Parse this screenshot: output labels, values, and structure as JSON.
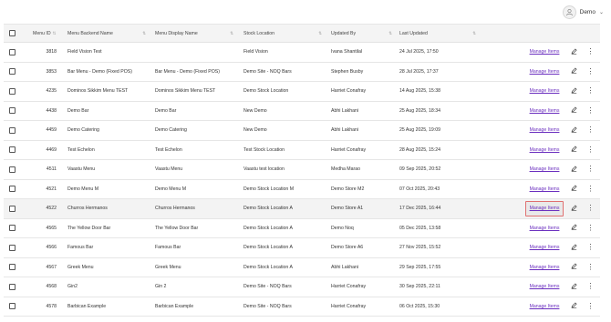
{
  "user": {
    "name": "Demo",
    "avatar_icon": "user-icon",
    "chevron_icon": "chevron-down-icon"
  },
  "table": {
    "headers": {
      "menu_id": "Menu ID",
      "backend_name": "Menu Backend Name",
      "display_name": "Menu Display Name",
      "stock_location": "Stock Location",
      "updated_by": "Updated By",
      "last_updated": "Last Updated"
    },
    "action_label": "Manage Items",
    "highlight_row": 8,
    "rows": [
      {
        "id": "3818",
        "backend": "Field Vision Test",
        "display": "",
        "stock": "Field Vision",
        "updated_by": "Ivana Shantilal",
        "last_updated": "24 Jul 2025, 17:50"
      },
      {
        "id": "3853",
        "backend": "Bar Menu - Demo (Fixed POS)",
        "display": "Bar Menu - Demo (Fixed POS)",
        "stock": "Demo Site - NOQ Bars",
        "updated_by": "Stephen Busby",
        "last_updated": "28 Jul 2025, 17:37"
      },
      {
        "id": "4235",
        "backend": "Dominos Sikkim Menu TEST",
        "display": "Dominos Sikkim Menu TEST",
        "stock": "Demo Stock Location",
        "updated_by": "Harriet Conafray",
        "last_updated": "14 Aug 2025, 15:38"
      },
      {
        "id": "4438",
        "backend": "Demo Bar",
        "display": "Demo Bar",
        "stock": "New Demo",
        "updated_by": "Abhi Lakhani",
        "last_updated": "25 Aug 2025, 18:34"
      },
      {
        "id": "4459",
        "backend": "Demo Catering",
        "display": "Demo Catering",
        "stock": "New Demo",
        "updated_by": "Abhi Lakhani",
        "last_updated": "25 Aug 2025, 19:09"
      },
      {
        "id": "4469",
        "backend": "Test Echelon",
        "display": "Test Echelon",
        "stock": "Test Stock Location",
        "updated_by": "Harriet Conafray",
        "last_updated": "28 Aug 2025, 15:24"
      },
      {
        "id": "4511",
        "backend": "Vaastu Menu",
        "display": "Vaastu Menu",
        "stock": "Vaastu test location",
        "updated_by": "Medha Marao",
        "last_updated": "09 Sep 2025, 20:52"
      },
      {
        "id": "4521",
        "backend": "Demo Menu M",
        "display": "Demo Menu M",
        "stock": "Demo Stock Location M",
        "updated_by": "Demo Store M2",
        "last_updated": "07 Oct 2025, 20:43"
      },
      {
        "id": "4522",
        "backend": "Churros Hermanos",
        "display": "Churros Hermanos",
        "stock": "Demo Stock Location A",
        "updated_by": "Demo Store A1",
        "last_updated": "17 Dec 2025, 16:44"
      },
      {
        "id": "4565",
        "backend": "The Yellow Door Bar",
        "display": "The Yellow Door Bar",
        "stock": "Demo Stock Location A",
        "updated_by": "Demo Noq",
        "last_updated": "05 Dec 2025, 13:58"
      },
      {
        "id": "4566",
        "backend": "Famous Bar",
        "display": "Famous Bar",
        "stock": "Demo Stock Location A",
        "updated_by": "Demo Store A6",
        "last_updated": "27 Nov 2025, 15:52"
      },
      {
        "id": "4567",
        "backend": "Greek Menu",
        "display": "Greek Menu",
        "stock": "Demo Stock Location A",
        "updated_by": "Abhi Lakhani",
        "last_updated": "29 Sep 2025, 17:55"
      },
      {
        "id": "4568",
        "backend": "Gin2",
        "display": "Gin 2",
        "stock": "Demo Site - NOQ Bars",
        "updated_by": "Harriet Conafray",
        "last_updated": "30 Sep 2025, 22:11"
      },
      {
        "id": "4578",
        "backend": "Barbican Example",
        "display": "Barbican Example",
        "stock": "Demo Site - NOQ Bars",
        "updated_by": "Harriet Conafray",
        "last_updated": "06 Oct 2025, 15:30"
      }
    ]
  }
}
